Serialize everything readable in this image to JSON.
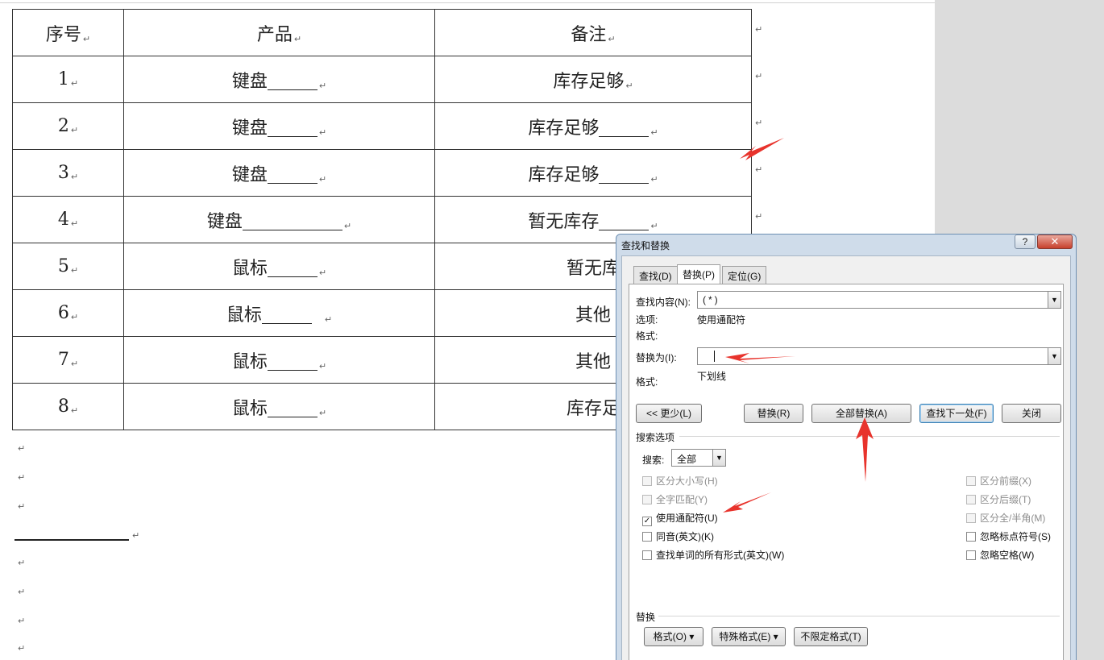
{
  "table": {
    "headers": [
      "序号",
      "产品",
      "备注"
    ],
    "rows": [
      {
        "num": "1",
        "product": "键盘",
        "note": "库存足够"
      },
      {
        "num": "2",
        "product": "键盘",
        "note": "库存足够"
      },
      {
        "num": "3",
        "product": "键盘",
        "note": "库存足够"
      },
      {
        "num": "4",
        "product": "键盘",
        "note": "暂无库存"
      },
      {
        "num": "5",
        "product": "鼠标",
        "note": "暂无库"
      },
      {
        "num": "6",
        "product": "鼠标",
        "note": "其他"
      },
      {
        "num": "7",
        "product": "鼠标",
        "note": "其他"
      },
      {
        "num": "8",
        "product": "鼠标",
        "note": "库存足"
      }
    ]
  },
  "marks": {
    "paragraph": "↵"
  },
  "dialog": {
    "title": "查找和替换",
    "help": "?",
    "close": "✕",
    "tabs": {
      "find": "查找(D)",
      "replace": "替换(P)",
      "goto": "定位(G)"
    },
    "find_label": "查找内容(N):",
    "find_value": "(*)",
    "options_label": "选项:",
    "options_value": "使用通配符",
    "format_label": "格式:",
    "replace_label": "替换为(I):",
    "replace_value": "",
    "replace_format_label": "格式:",
    "replace_format_value": "下划线",
    "buttons": {
      "less": "<< 更少(L)",
      "replace": "替换(R)",
      "replace_all": "全部替换(A)",
      "find_next": "查找下一处(F)",
      "close": "关闭"
    },
    "search_options_title": "搜索选项",
    "search_label": "搜索:",
    "search_value": "全部",
    "checkboxes_left": [
      {
        "label": "区分大小写(H)",
        "checked": false,
        "disabled": true
      },
      {
        "label": "全字匹配(Y)",
        "checked": false,
        "disabled": true
      },
      {
        "label": "使用通配符(U)",
        "checked": true,
        "disabled": false
      },
      {
        "label": "同音(英文)(K)",
        "checked": false,
        "disabled": false
      },
      {
        "label": "查找单词的所有形式(英文)(W)",
        "checked": false,
        "disabled": false
      }
    ],
    "checkboxes_right": [
      {
        "label": "区分前缀(X)",
        "checked": false,
        "disabled": true
      },
      {
        "label": "区分后缀(T)",
        "checked": false,
        "disabled": true
      },
      {
        "label": "区分全/半角(M)",
        "checked": false,
        "disabled": true
      },
      {
        "label": "忽略标点符号(S)",
        "checked": false,
        "disabled": false
      },
      {
        "label": "忽略空格(W)",
        "checked": false,
        "disabled": false
      }
    ],
    "replace_section_title": "替换",
    "bottom_buttons": {
      "format": "格式(O) ▾",
      "special": "特殊格式(E) ▾",
      "no_format": "不限定格式(T)"
    }
  },
  "colors": {
    "annotation_arrow": "#e8332c",
    "dialog_frame": "#cfdcea"
  }
}
